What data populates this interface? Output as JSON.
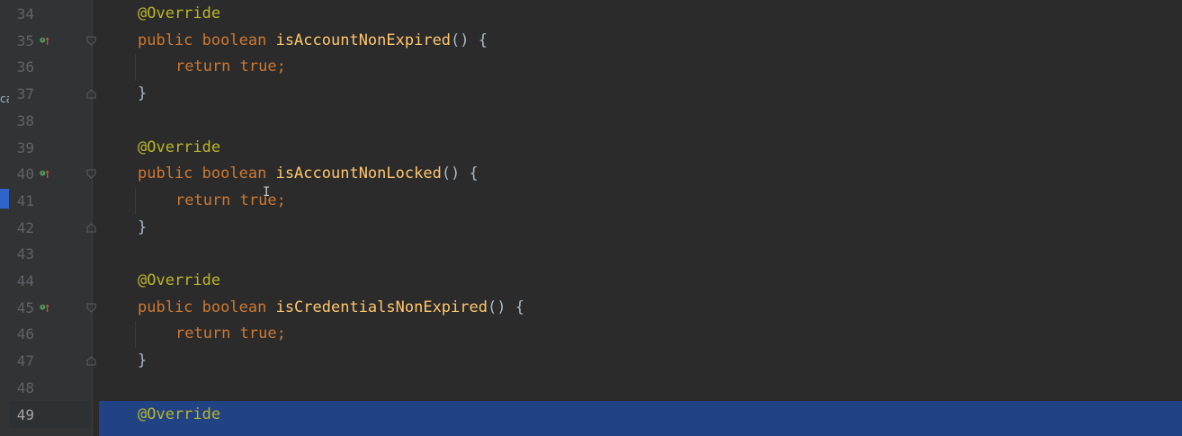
{
  "editor": {
    "left_strip_fragment": "ca",
    "lines": [
      {
        "num": "34",
        "tokens": [
          {
            "t": "@Override",
            "c": "ann"
          }
        ],
        "indent": 0
      },
      {
        "num": "35",
        "override_icon": true,
        "fold": "open",
        "tokens": [
          {
            "t": "public",
            "c": "kw"
          },
          {
            "t": " "
          },
          {
            "t": "boolean",
            "c": "kw"
          },
          {
            "t": " "
          },
          {
            "t": "isAccountNonExpired",
            "c": "fn"
          },
          {
            "t": "() {",
            "c": "punc"
          }
        ],
        "indent": 0
      },
      {
        "num": "36",
        "tokens": [
          {
            "t": "return",
            "c": "kw"
          },
          {
            "t": " "
          },
          {
            "t": "true",
            "c": "kw"
          },
          {
            "t": ";",
            "c": "kw"
          }
        ],
        "indent": 1
      },
      {
        "num": "37",
        "fold": "close",
        "tokens": [
          {
            "t": "}",
            "c": "punc"
          }
        ],
        "indent": 0
      },
      {
        "num": "38",
        "tokens": [],
        "indent": 0
      },
      {
        "num": "39",
        "tokens": [
          {
            "t": "@Override",
            "c": "ann"
          }
        ],
        "indent": 0
      },
      {
        "num": "40",
        "override_icon": true,
        "fold": "open",
        "tokens": [
          {
            "t": "public",
            "c": "kw"
          },
          {
            "t": " "
          },
          {
            "t": "boolean",
            "c": "kw"
          },
          {
            "t": " "
          },
          {
            "t": "isAccountNonLocked",
            "c": "fn"
          },
          {
            "t": "() {",
            "c": "punc"
          }
        ],
        "indent": 0
      },
      {
        "num": "41",
        "tokens": [
          {
            "t": "return",
            "c": "kw"
          },
          {
            "t": " "
          },
          {
            "t": "true",
            "c": "kw"
          },
          {
            "t": ";",
            "c": "kw"
          }
        ],
        "indent": 1
      },
      {
        "num": "42",
        "fold": "close",
        "tokens": [
          {
            "t": "}",
            "c": "punc"
          }
        ],
        "indent": 0
      },
      {
        "num": "43",
        "tokens": [],
        "indent": 0
      },
      {
        "num": "44",
        "tokens": [
          {
            "t": "@Override",
            "c": "ann"
          }
        ],
        "indent": 0
      },
      {
        "num": "45",
        "override_icon": true,
        "fold": "open",
        "tokens": [
          {
            "t": "public",
            "c": "kw"
          },
          {
            "t": " "
          },
          {
            "t": "boolean",
            "c": "kw"
          },
          {
            "t": " "
          },
          {
            "t": "isCredentialsNonExpired",
            "c": "fn"
          },
          {
            "t": "() {",
            "c": "punc"
          }
        ],
        "indent": 0
      },
      {
        "num": "46",
        "tokens": [
          {
            "t": "return",
            "c": "kw"
          },
          {
            "t": " "
          },
          {
            "t": "true",
            "c": "kw"
          },
          {
            "t": ";",
            "c": "kw"
          }
        ],
        "indent": 1
      },
      {
        "num": "47",
        "fold": "close",
        "tokens": [
          {
            "t": "}",
            "c": "punc"
          }
        ],
        "indent": 0
      },
      {
        "num": "48",
        "tokens": [],
        "indent": 0
      },
      {
        "num": "49",
        "current": true,
        "tokens": [
          {
            "t": "@Override",
            "c": "ann"
          }
        ],
        "indent": 0
      }
    ]
  },
  "colors": {
    "background": "#2b2b2b",
    "gutter": "#313335",
    "keyword": "#cc7832",
    "annotation": "#bbb529",
    "method": "#ffc66d",
    "selection": "#214283",
    "override_icon_green": "#499c54",
    "override_icon_red": "#c75450"
  }
}
